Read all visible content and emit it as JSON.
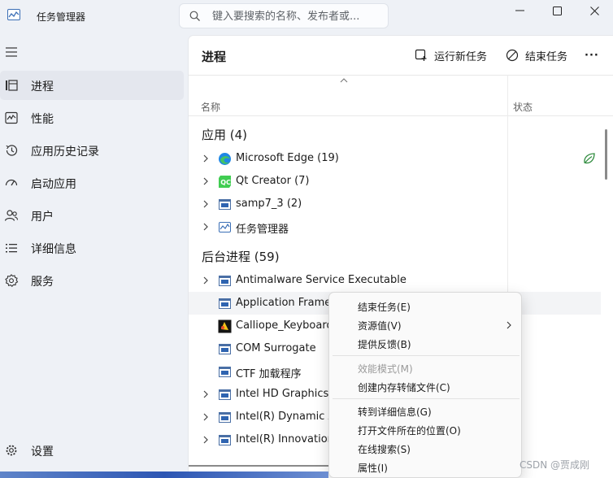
{
  "window": {
    "title": "任务管理器",
    "search_placeholder": "键入要搜索的名称、发布者或..."
  },
  "sidebar": {
    "items": [
      {
        "label": "进程",
        "icon": "processes-icon"
      },
      {
        "label": "性能",
        "icon": "performance-icon"
      },
      {
        "label": "应用历史记录",
        "icon": "app-history-icon"
      },
      {
        "label": "启动应用",
        "icon": "startup-icon"
      },
      {
        "label": "用户",
        "icon": "users-icon"
      },
      {
        "label": "详细信息",
        "icon": "details-icon"
      },
      {
        "label": "服务",
        "icon": "services-icon"
      }
    ],
    "settings_label": "设置"
  },
  "main": {
    "title": "进程",
    "run_new_task": "运行新任务",
    "end_task": "结束任务",
    "more": "···",
    "col_name": "名称",
    "col_status": "状态",
    "groups": {
      "apps_title": "应用 (4)",
      "background_title": "后台进程 (59)"
    },
    "apps": [
      {
        "name": "Microsoft Edge (19)",
        "icon": "edge-icon",
        "expandable": true
      },
      {
        "name": "Qt Creator (7)",
        "icon": "qt-icon",
        "expandable": true
      },
      {
        "name": "samp7_3 (2)",
        "icon": "app-window-icon",
        "expandable": true
      },
      {
        "name": "任务管理器",
        "icon": "task-manager-icon",
        "expandable": true
      }
    ],
    "background": [
      {
        "name": "Antimalware Service Executable",
        "icon": "app-window-icon",
        "expandable": true
      },
      {
        "name": "Application Frame H",
        "icon": "app-window-icon",
        "expandable": false
      },
      {
        "name": "Calliope_Keyboard",
        "icon": "calliope-icon",
        "expandable": false
      },
      {
        "name": "COM Surrogate",
        "icon": "app-window-icon",
        "expandable": false
      },
      {
        "name": "CTF 加载程序",
        "icon": "app-window-icon",
        "expandable": false
      },
      {
        "name": "Intel HD Graphics D",
        "icon": "app-window-icon",
        "expandable": true
      },
      {
        "name": "Intel(R) Dynamic Ap",
        "icon": "app-window-icon",
        "expandable": true
      },
      {
        "name": "Intel(R) Innovation P",
        "icon": "app-window-icon",
        "expandable": true
      }
    ]
  },
  "context_menu": {
    "items": [
      {
        "label": "结束任务(E)",
        "disabled": false
      },
      {
        "label": "资源值(V)",
        "disabled": false,
        "submenu": true
      },
      {
        "label": "提供反馈(B)",
        "disabled": false
      },
      {
        "label": "效能模式(M)",
        "disabled": true
      },
      {
        "label": "创建内存转储文件(C)",
        "disabled": false
      },
      {
        "label": "转到详细信息(G)",
        "disabled": false
      },
      {
        "label": "打开文件所在的位置(O)",
        "disabled": false
      },
      {
        "label": "在线搜索(S)",
        "disabled": false
      },
      {
        "label": "属性(I)",
        "disabled": false
      }
    ]
  },
  "watermark": "CSDN @贾成刚",
  "colors": {
    "accent": "#0067c0",
    "eco_green": "#2e8b3d",
    "sidebar_bg": "#eef1f6"
  }
}
